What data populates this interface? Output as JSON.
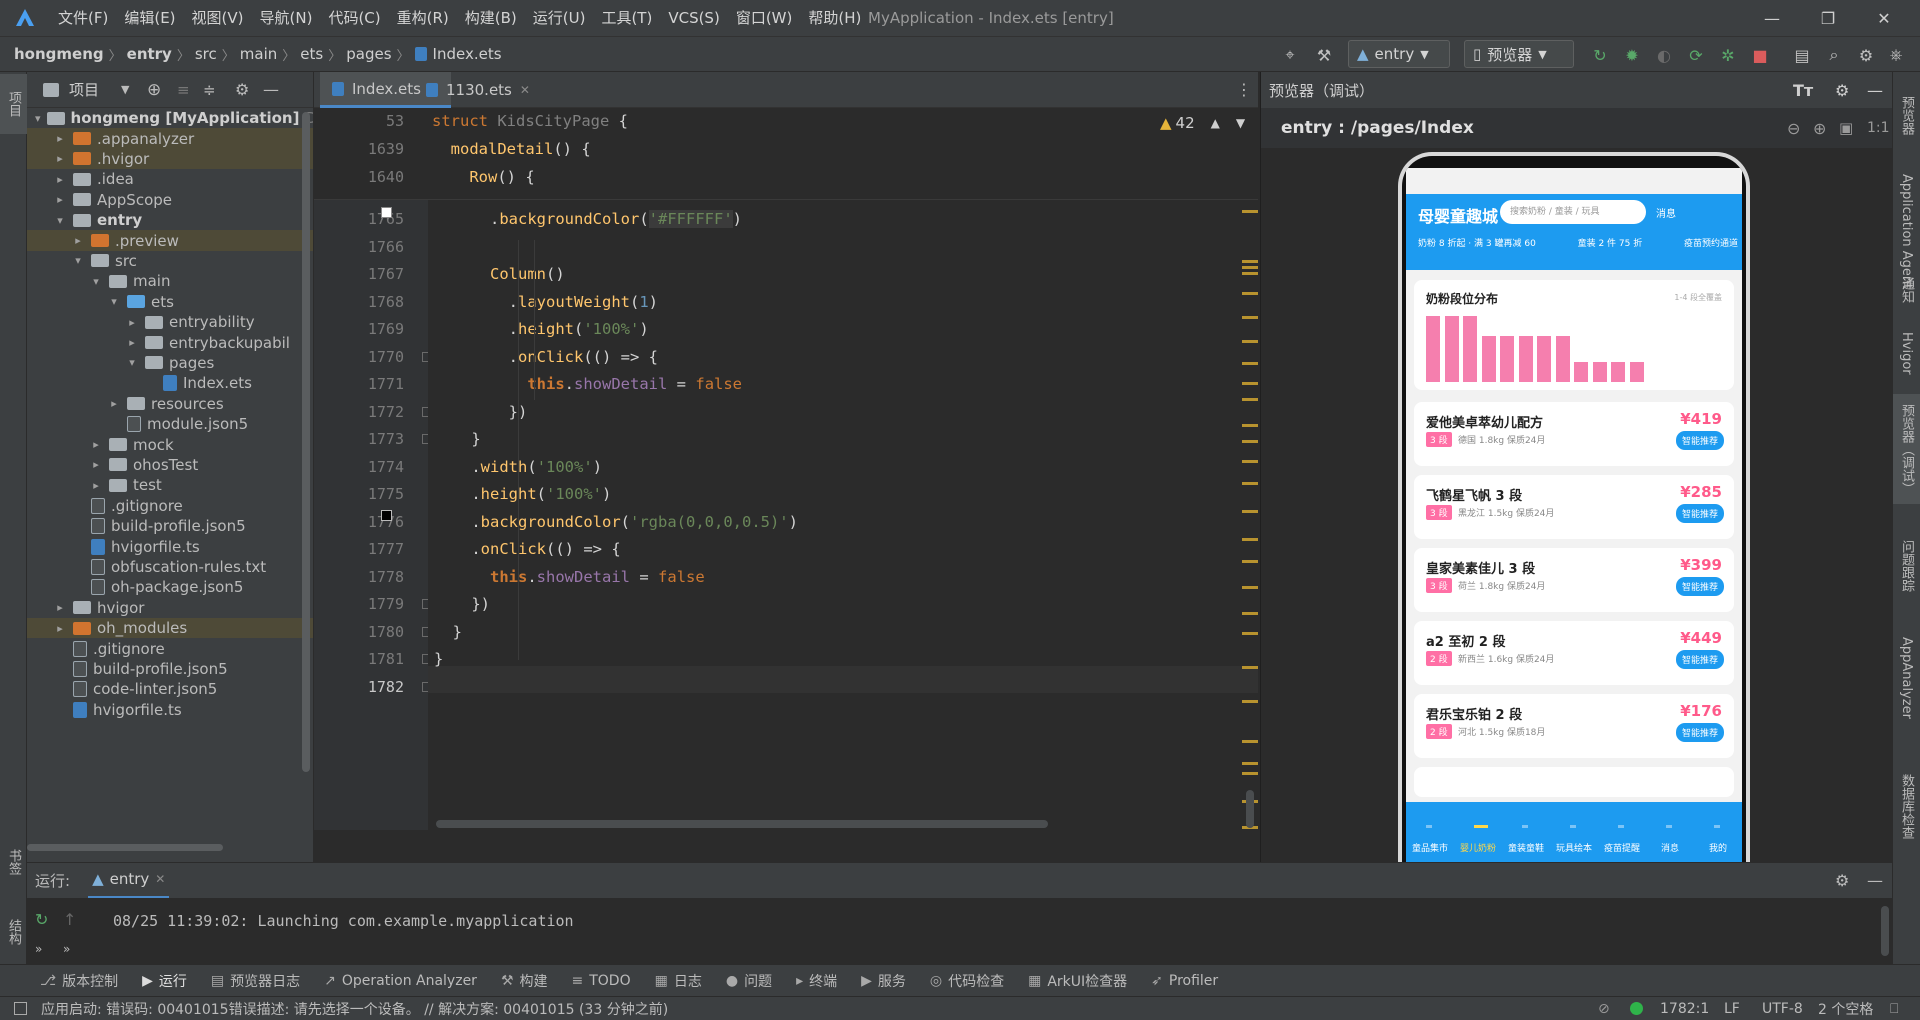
{
  "window": {
    "title": "MyApplication - Index.ets [entry]"
  },
  "menu": [
    "文件(F)",
    "编辑(E)",
    "视图(V)",
    "导航(N)",
    "代码(C)",
    "重构(R)",
    "构建(B)",
    "运行(U)",
    "工具(T)",
    "VCS(S)",
    "窗口(W)",
    "帮助(H)"
  ],
  "breadcrumb": [
    "hongmeng",
    "entry",
    "src",
    "main",
    "ets",
    "pages",
    "Index.ets"
  ],
  "toolbar": {
    "run_config": "entry",
    "device": "预览器"
  },
  "left_strip": {
    "project": "项目",
    "bookmarks": "书签",
    "structure": "结构"
  },
  "project": {
    "title": "项目",
    "tree": [
      {
        "label": "hongmeng [MyApplication]",
        "suffix": "D:",
        "type": "folder-grey",
        "depth": 0,
        "arrow": "▾",
        "style": "root"
      },
      {
        "label": ".appanalyzer",
        "type": "folder-orange",
        "depth": 1,
        "arrow": "▸",
        "style": "hl"
      },
      {
        "label": ".hvigor",
        "type": "folder-orange",
        "depth": 1,
        "arrow": "▸",
        "style": "hl"
      },
      {
        "label": ".idea",
        "type": "folder-grey",
        "depth": 1,
        "arrow": "▸"
      },
      {
        "label": "AppScope",
        "type": "folder-grey",
        "depth": 1,
        "arrow": "▸"
      },
      {
        "label": "entry",
        "type": "folder-grey",
        "depth": 1,
        "arrow": "▾",
        "style": "bold"
      },
      {
        "label": ".preview",
        "type": "folder-orange",
        "depth": 2,
        "arrow": "▸",
        "style": "hl"
      },
      {
        "label": "src",
        "type": "folder-grey",
        "depth": 2,
        "arrow": "▾"
      },
      {
        "label": "main",
        "type": "folder-grey",
        "depth": 3,
        "arrow": "▾"
      },
      {
        "label": "ets",
        "type": "folder-blue",
        "depth": 4,
        "arrow": "▾"
      },
      {
        "label": "entryability",
        "type": "folder-grey",
        "depth": 5,
        "arrow": "▸"
      },
      {
        "label": "entrybackupabil",
        "type": "folder-grey",
        "depth": 5,
        "arrow": "▸"
      },
      {
        "label": "pages",
        "type": "folder-grey",
        "depth": 5,
        "arrow": "▾"
      },
      {
        "label": "Index.ets",
        "type": "file-ts",
        "depth": 6,
        "arrow": ""
      },
      {
        "label": "resources",
        "type": "folder-grey",
        "depth": 4,
        "arrow": "▸"
      },
      {
        "label": "module.json5",
        "type": "file",
        "depth": 4,
        "arrow": ""
      },
      {
        "label": "mock",
        "type": "folder-grey",
        "depth": 3,
        "arrow": "▸"
      },
      {
        "label": "ohosTest",
        "type": "folder-grey",
        "depth": 3,
        "arrow": "▸"
      },
      {
        "label": "test",
        "type": "folder-grey",
        "depth": 3,
        "arrow": "▸"
      },
      {
        "label": ".gitignore",
        "type": "file",
        "depth": 2,
        "arrow": ""
      },
      {
        "label": "build-profile.json5",
        "type": "file",
        "depth": 2,
        "arrow": ""
      },
      {
        "label": "hvigorfile.ts",
        "type": "file-ts",
        "depth": 2,
        "arrow": ""
      },
      {
        "label": "obfuscation-rules.txt",
        "type": "file",
        "depth": 2,
        "arrow": ""
      },
      {
        "label": "oh-package.json5",
        "type": "file",
        "depth": 2,
        "arrow": ""
      },
      {
        "label": "hvigor",
        "type": "folder-grey",
        "depth": 1,
        "arrow": "▸"
      },
      {
        "label": "oh_modules",
        "type": "folder-orange",
        "depth": 1,
        "arrow": "▸",
        "style": "hl"
      },
      {
        "label": ".gitignore",
        "type": "file",
        "depth": 1,
        "arrow": ""
      },
      {
        "label": "build-profile.json5",
        "type": "file",
        "depth": 1,
        "arrow": ""
      },
      {
        "label": "code-linter.json5",
        "type": "file",
        "depth": 1,
        "arrow": ""
      },
      {
        "label": "hvigorfile.ts",
        "type": "file-ts",
        "depth": 1,
        "arrow": ""
      }
    ]
  },
  "editor": {
    "tabs": [
      {
        "label": "Index.ets",
        "active": true
      },
      {
        "label": "1130.ets",
        "active": false
      }
    ],
    "warnings": "42",
    "sticky": [
      {
        "num": "53",
        "html": "<span class=\"kw\">struct</span> <span class=\"grey\">KidsCityPage</span> <span class=\"pu\">{</span>"
      },
      {
        "num": "1639",
        "html": "  <span class=\"fn\">modalDetail</span><span class=\"pu\">() {</span>"
      },
      {
        "num": "1640",
        "html": "    <span class=\"fn\">Row</span><span class=\"pu\">() {</span>"
      }
    ],
    "lines": [
      {
        "num": "1765",
        "html": "      <span class=\"pu\">.</span><span class=\"fn\">backgroundColor</span><span class=\"pu\">(</span><span class=\"st\" style=\"background:#3b3b3b\">'#FFFFFF'</span><span class=\"pu\">)</span>"
      },
      {
        "num": "1766",
        "html": ""
      },
      {
        "num": "1767",
        "html": "      <span class=\"fn\">Column</span><span class=\"pu\">()</span>"
      },
      {
        "num": "1768",
        "html": "        <span class=\"pu\">.</span><span class=\"fn\">layoutWeight</span><span class=\"pu\">(</span><span class=\"nu\">1</span><span class=\"pu\">)</span>"
      },
      {
        "num": "1769",
        "html": "        <span class=\"pu\">.</span><span class=\"fn\">height</span><span class=\"pu\">(</span><span class=\"st\">'100%'</span><span class=\"pu\">)</span>"
      },
      {
        "num": "1770",
        "html": "        <span class=\"pu\">.</span><span class=\"fn\">onClick</span><span class=\"pu\">(() => {</span>"
      },
      {
        "num": "1771",
        "html": "          <span class=\"th\">this</span><span class=\"pu\">.</span><span class=\"sty\">showDetail</span> <span class=\"pu\">=</span> <span class=\"kw\">false</span>"
      },
      {
        "num": "1772",
        "html": "        <span class=\"pu\">})</span>"
      },
      {
        "num": "1773",
        "html": "    <span class=\"pu\">}</span>"
      },
      {
        "num": "1774",
        "html": "    <span class=\"pu\">.</span><span class=\"fn\">width</span><span class=\"pu\">(</span><span class=\"st\">'100%'</span><span class=\"pu\">)</span>"
      },
      {
        "num": "1775",
        "html": "    <span class=\"pu\">.</span><span class=\"fn\">height</span><span class=\"pu\">(</span><span class=\"st\">'100%'</span><span class=\"pu\">)</span>"
      },
      {
        "num": "1776",
        "html": "    <span class=\"pu\">.</span><span class=\"fn\">backgroundColor</span><span class=\"pu\">(</span><span class=\"st\">'rgba(0,0,0,0.5)'</span><span class=\"pu\">)</span>"
      },
      {
        "num": "1777",
        "html": "    <span class=\"pu\">.</span><span class=\"fn\">onClick</span><span class=\"pu\">(() => {</span>"
      },
      {
        "num": "1778",
        "html": "      <span class=\"th\">this</span><span class=\"pu\">.</span><span class=\"sty\">showDetail</span> <span class=\"pu\">=</span> <span class=\"kw\">false</span>"
      },
      {
        "num": "1779",
        "html": "    <span class=\"pu\">})</span>"
      },
      {
        "num": "1780",
        "html": "  <span class=\"pu\">}</span>"
      },
      {
        "num": "1781",
        "html": "<span class=\"pu\">}</span>"
      },
      {
        "num": "1782",
        "html": ""
      }
    ]
  },
  "preview": {
    "title": "预览器（调试）",
    "route": "entry : /pages/Index",
    "zoom_label": "1:1",
    "app": {
      "name": "母婴童趣城",
      "search_placeholder": "搜索奶粉 / 童装 / 玩具",
      "message": "消息",
      "promos": [
        "奶粉 8 折起 · 满 3 罐再减 60",
        "童装 2 件 75 折",
        "疫苗预约通道"
      ],
      "chart_title": "奶粉段位分布",
      "chart_note": "1-4 段全覆盖",
      "products": [
        {
          "name": "爱他美卓萃幼儿配方",
          "price": "¥419",
          "stage": "3 段",
          "meta": "德国  1.8kg  保质24月",
          "btn": "智能推荐"
        },
        {
          "name": "飞鹤星飞帆 3 段",
          "price": "¥285",
          "stage": "3 段",
          "meta": "黑龙江  1.5kg  保质24月",
          "btn": "智能推荐"
        },
        {
          "name": "皇家美素佳儿 3 段",
          "price": "¥399",
          "stage": "3 段",
          "meta": "荷兰  1.8kg  保质24月",
          "btn": "智能推荐"
        },
        {
          "name": "a2 至初 2 段",
          "price": "¥449",
          "stage": "2 段",
          "meta": "新西兰  1.6kg  保质24月",
          "btn": "智能推荐"
        },
        {
          "name": "君乐宝乐铂 2 段",
          "price": "¥176",
          "stage": "2 段",
          "meta": "河北  1.5kg  保质18月",
          "btn": "智能推荐"
        }
      ],
      "nav": [
        "童品集市",
        "婴儿奶粉",
        "童装童鞋",
        "玩具绘本",
        "疫苗提醒",
        "消息",
        "我的"
      ],
      "nav_active": 1
    }
  },
  "chart_data": {
    "type": "bar",
    "title": "奶粉段位分布",
    "values": [
      10,
      10,
      10,
      7,
      7,
      7,
      7,
      7,
      3,
      3,
      3,
      3
    ],
    "ylim": [
      0,
      10
    ],
    "grid": false,
    "color": "#f57fae"
  },
  "right_strip": [
    "预览器",
    "Application Agent",
    "通知",
    "Hvigor",
    "预览器（调试）",
    "问题跟踪",
    "AppAnalyzer",
    "数据库检查"
  ],
  "run": {
    "label": "运行:",
    "config": "entry",
    "log": "08/25 11:39:02: Launching com.example.myapplication"
  },
  "bottom_tabs": [
    "版本控制",
    "运行",
    "预览器日志",
    "Operation Analyzer",
    "构建",
    "TODO",
    "日志",
    "问题",
    "终端",
    "服务",
    "代码检查",
    "ArkUI检查器",
    "Profiler"
  ],
  "status": {
    "message": "应用启动: 错误码: 00401015错误描述: 请先选择一个设备。 // 解决方案: 00401015 (33 分钟之前)",
    "position": "1782:1",
    "line_sep": "LF",
    "encoding": "UTF-8",
    "indent": "2 个空格"
  },
  "colors": {
    "accent": "#1d9bf0",
    "pink": "#f57fae",
    "tab_underline": "#4a88c7"
  }
}
